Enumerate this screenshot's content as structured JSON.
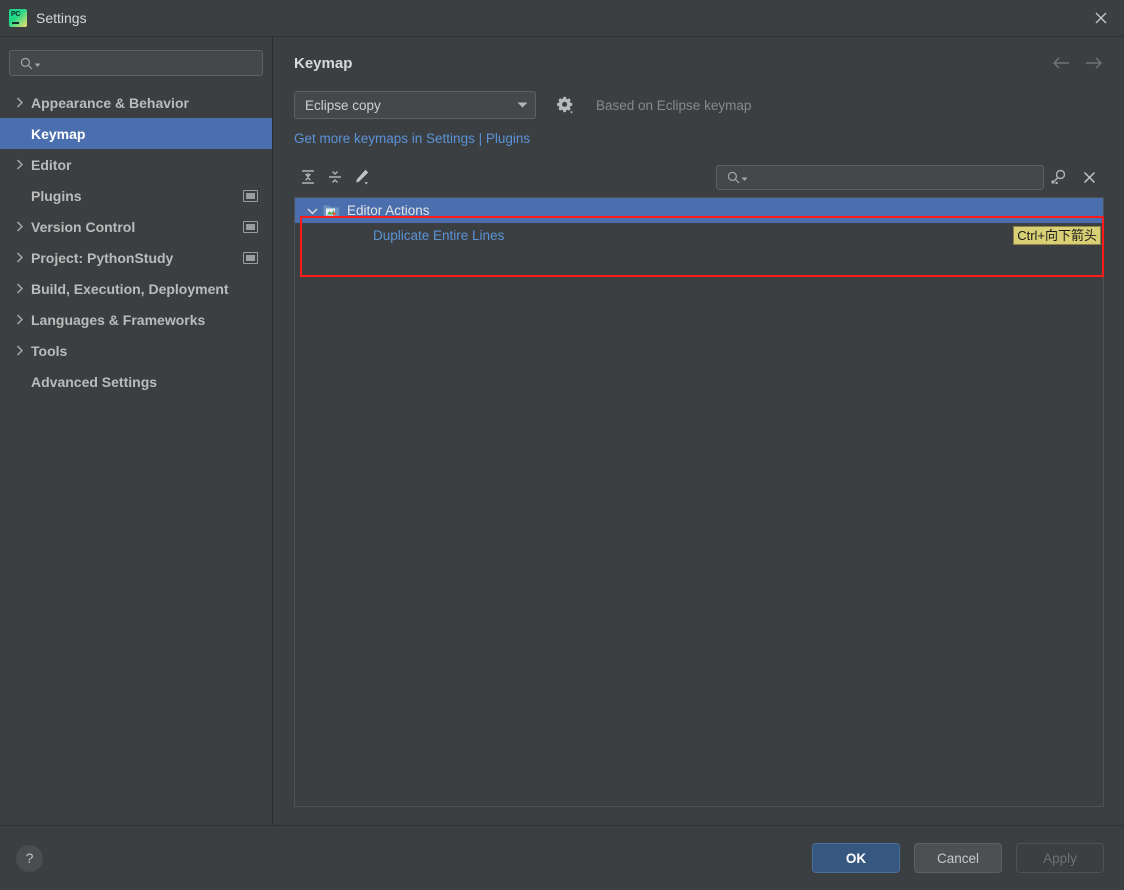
{
  "window": {
    "title": "Settings",
    "app_icon": "pycharm-icon",
    "close_icon": "close-icon"
  },
  "sidebar": {
    "search": {
      "value": "",
      "placeholder": "",
      "icon": "search-icon"
    },
    "items": [
      {
        "label": "Appearance & Behavior",
        "expandable": true,
        "selected": false,
        "badge": false
      },
      {
        "label": "Keymap",
        "expandable": false,
        "selected": true,
        "badge": false
      },
      {
        "label": "Editor",
        "expandable": true,
        "selected": false,
        "badge": false
      },
      {
        "label": "Plugins",
        "expandable": false,
        "selected": false,
        "badge": true
      },
      {
        "label": "Version Control",
        "expandable": true,
        "selected": false,
        "badge": true
      },
      {
        "label": "Project: PythonStudy",
        "expandable": true,
        "selected": false,
        "badge": true
      },
      {
        "label": "Build, Execution, Deployment",
        "expandable": true,
        "selected": false,
        "badge": false
      },
      {
        "label": "Languages & Frameworks",
        "expandable": true,
        "selected": false,
        "badge": false
      },
      {
        "label": "Tools",
        "expandable": true,
        "selected": false,
        "badge": false
      },
      {
        "label": "Advanced Settings",
        "expandable": false,
        "selected": false,
        "badge": false
      }
    ]
  },
  "content": {
    "title": "Keymap",
    "nav": {
      "back_icon": "arrow-left-icon",
      "forward_icon": "arrow-right-icon"
    },
    "keymap_select": {
      "value": "Eclipse copy",
      "arrow_icon": "chevron-down-icon"
    },
    "gear_icon": "gear-icon",
    "based_on": "Based on Eclipse keymap",
    "link": "Get more keymaps in Settings | Plugins",
    "toolbar": {
      "expand_all_icon": "expand-all-icon",
      "collapse_all_icon": "collapse-all-icon",
      "edit_icon": "pencil-edit-icon",
      "search": {
        "value": "",
        "placeholder": "",
        "icon": "search-icon"
      },
      "find_shortcut_icon": "find-by-shortcut-icon",
      "clear_icon": "close-icon"
    },
    "tree": [
      {
        "label": "Editor Actions",
        "type": "group",
        "icon": "folder-actions-icon",
        "expanded": true,
        "selected": true,
        "shortcut": ""
      },
      {
        "label": "Duplicate Entire Lines",
        "type": "leaf",
        "icon": "",
        "expanded": false,
        "selected": false,
        "shortcut": "Ctrl+向下箭头"
      }
    ]
  },
  "footer": {
    "help_label": "?",
    "ok_label": "OK",
    "cancel_label": "Cancel",
    "apply_label": "Apply"
  },
  "colors": {
    "selection_blue": "#4b6eaf",
    "link_blue": "#5a93d8",
    "shortcut_yellow": "#d9cf74",
    "annotation_red": "#ff1a1a",
    "primary_button": "#365880",
    "panel_bg": "#3c3f41"
  }
}
